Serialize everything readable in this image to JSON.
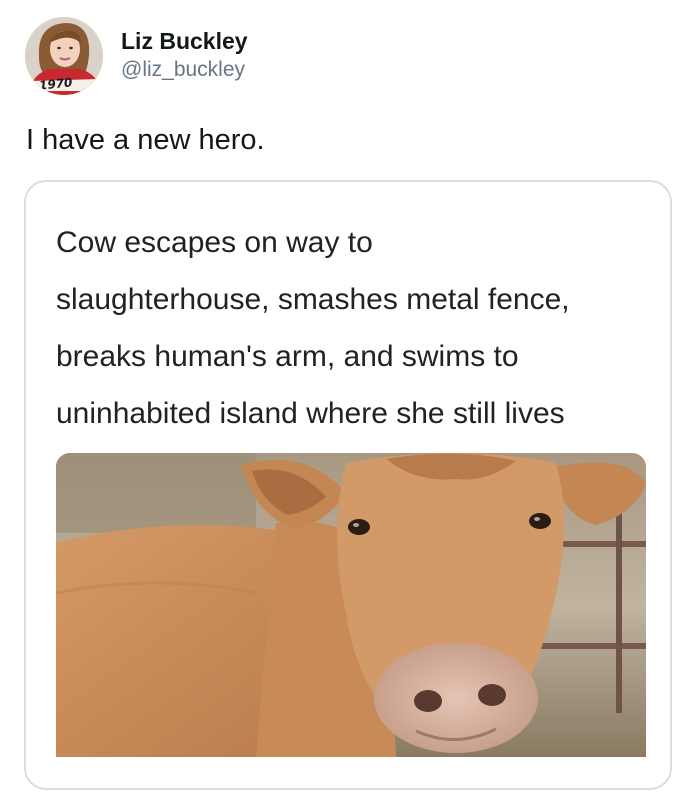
{
  "user": {
    "display_name": "Liz Buckley",
    "handle": "@liz_buckley",
    "avatar_shirt_text": "1970"
  },
  "tweet": {
    "text": "I have a new hero."
  },
  "card": {
    "headline_lines": [
      "Cow escapes on way to",
      "slaughterhouse, smashes metal fence,",
      "breaks human's arm, and swims to",
      "uninhabited island where she still lives"
    ],
    "image_icon": "cow-photo"
  },
  "colors": {
    "name": "#14171a",
    "handle": "#657786",
    "card_border": "#d8dee2",
    "cow_fur": "#c48a5a"
  }
}
